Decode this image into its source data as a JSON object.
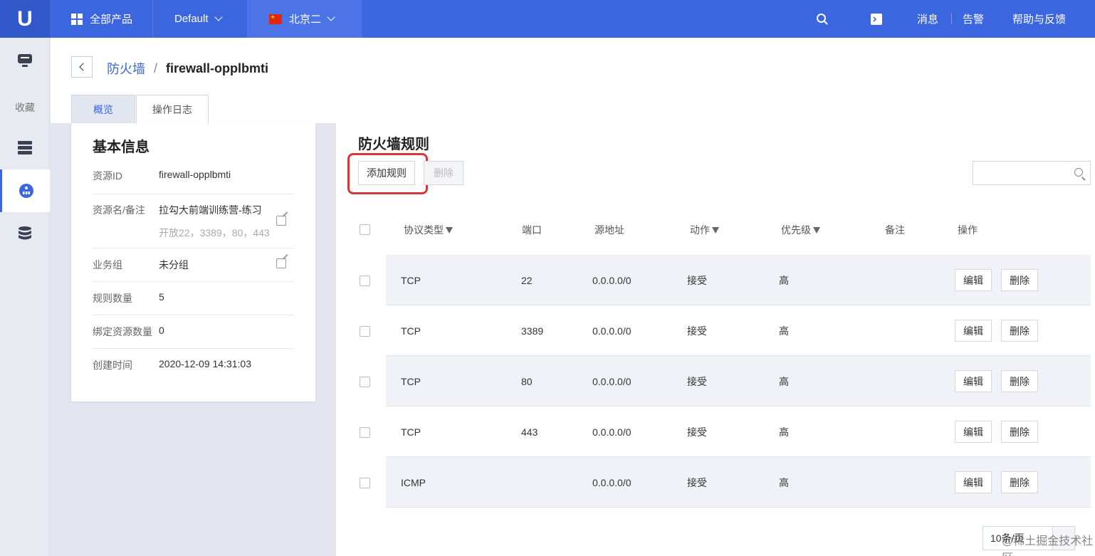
{
  "topbar": {
    "logo": "U",
    "products": "全部产品",
    "project": "Default",
    "region": "北京二",
    "messages": "消息",
    "alarm": "告警",
    "help": "帮助与反馈",
    "icons": [
      "search-icon",
      "terminal-icon",
      "grid-icon",
      "china-flag-icon",
      "chevron-down-icon"
    ]
  },
  "sidebar": {
    "favorites": "收藏",
    "icons": [
      "monitor-icon",
      "server-list-icon",
      "firewall-network-icon",
      "database-icon"
    ]
  },
  "breadcrumb": {
    "parent": "防火墙",
    "separator": "/",
    "current": "firewall-opplbmti"
  },
  "tabs": [
    {
      "label": "概览"
    },
    {
      "label": "操作日志"
    }
  ],
  "info": {
    "title": "基本信息",
    "rows": [
      {
        "key": "资源ID",
        "value": "firewall-opplbmti"
      },
      {
        "key": "资源名/备注",
        "value": "拉勾大前端训练营-练习",
        "sub": "开放22，3389，80，443"
      },
      {
        "key": "业务组",
        "value": "未分组"
      },
      {
        "key": "规则数量",
        "value": "5"
      },
      {
        "key": "绑定资源数量",
        "value": "0"
      },
      {
        "key": "创建时间",
        "value": "2020-12-09 14:31:03"
      }
    ]
  },
  "rules": {
    "title": "防火墙规则",
    "add_label": "添加规则",
    "delete_label": "删除",
    "search_placeholder": "",
    "columns": [
      "协议类型",
      "端口",
      "源地址",
      "动作",
      "优先级",
      "备注",
      "操作"
    ],
    "rows": [
      {
        "protocol": "TCP",
        "port": "22",
        "source": "0.0.0.0/0",
        "action": "接受",
        "priority": "高",
        "note": ""
      },
      {
        "protocol": "TCP",
        "port": "3389",
        "source": "0.0.0.0/0",
        "action": "接受",
        "priority": "高",
        "note": ""
      },
      {
        "protocol": "TCP",
        "port": "80",
        "source": "0.0.0.0/0",
        "action": "接受",
        "priority": "高",
        "note": ""
      },
      {
        "protocol": "TCP",
        "port": "443",
        "source": "0.0.0.0/0",
        "action": "接受",
        "priority": "高",
        "note": ""
      },
      {
        "protocol": "ICMP",
        "port": "",
        "source": "0.0.0.0/0",
        "action": "接受",
        "priority": "高",
        "note": ""
      }
    ],
    "row_actions": {
      "edit": "编辑",
      "delete": "删除"
    },
    "pager": "10条/页",
    "watermark": "@稀土掘金技术社区"
  }
}
